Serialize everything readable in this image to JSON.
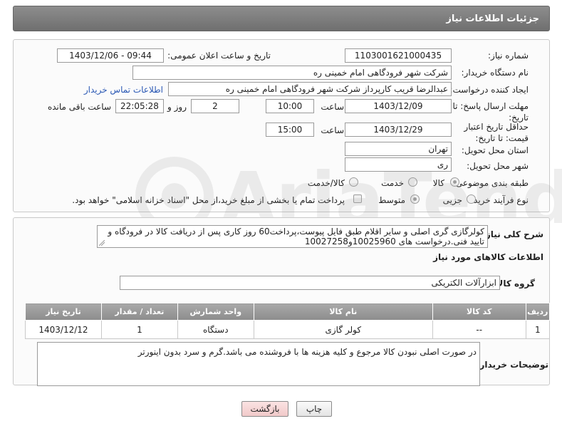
{
  "header": {
    "title": "جزئیات اطلاعات نیاز"
  },
  "form": {
    "need_number_label": "شماره نیاز:",
    "need_number": "1103001621000435",
    "announce_label": "تاریخ و ساعت اعلان عمومی:",
    "announce_value": "1403/12/06 - 09:44",
    "buyer_label": "نام دستگاه خریدار:",
    "buyer_value": "شرکت شهر فرودگاهی امام خمینی  ره",
    "creator_label": "ایجاد کننده درخواست:",
    "creator_value": "عبدالرضا قریب کارپرداز شرکت شهر فرودگاهی امام خمینی  ره",
    "contact_link": "اطلاعات تماس خریدار",
    "deadline_label": "مهلت ارسال پاسخ: تا تاریخ:",
    "deadline_date": "1403/12/09",
    "time_label": "ساعت",
    "deadline_time": "10:00",
    "days_count": "2",
    "days_label": "روز و",
    "remaining_time": "22:05:28",
    "remaining_label": "ساعت باقی مانده",
    "price_validity_label": "حداقل تاریخ اعتبار قیمت: تا تاریخ:",
    "price_validity_date": "1403/12/29",
    "price_validity_time": "15:00",
    "province_label": "استان محل تحویل:",
    "province_value": "تهران",
    "city_label": "شهر محل تحویل:",
    "city_value": "ری",
    "category_label": "طبقه بندی موضوعی:",
    "category_options": [
      "کالا",
      "خدمت",
      "کالا/خدمت"
    ],
    "process_label": "نوع فرآیند خرید :",
    "process_options": [
      "جزیی",
      "متوسط"
    ],
    "payment_note": "پرداخت تمام یا بخشی از مبلغ خرید،از محل \"اسناد خزانه اسلامی\" خواهد بود."
  },
  "description": {
    "label": "شرح کلی نیاز:",
    "text": "کولرگازی گری اصلی و سایر اقلام طبق فایل پیوست،پرداخت60 روز کاری پس از دریافت کالا در فرودگاه و تایید فنی.درخواست های 10025960و10027258"
  },
  "goods_info": {
    "title": "اطلاعات کالاهای مورد نیاز",
    "group_label": "گروه کالا:",
    "group_value": "ابزارآلات الکتریکی"
  },
  "table": {
    "headers": [
      "ردیف",
      "کد کالا",
      "نام کالا",
      "واحد شمارش",
      "تعداد / مقدار",
      "تاریخ نیاز"
    ],
    "rows": [
      [
        "1",
        "--",
        "کولر گازی",
        "دستگاه",
        "1",
        "1403/12/12"
      ]
    ]
  },
  "buyer_notes": {
    "label": "توضیحات خریدار:",
    "text": "در صورت اصلی نبودن کالا مرجوع و کلیه هزینه ها با فروشنده می باشد.گرم و سرد بدون اینورتر"
  },
  "buttons": {
    "print": "چاپ",
    "back": "بازگشت"
  },
  "colors": {
    "header_bg": "#7d7d7d",
    "link": "#2a58b4",
    "back_button": "#f7d6d6"
  }
}
